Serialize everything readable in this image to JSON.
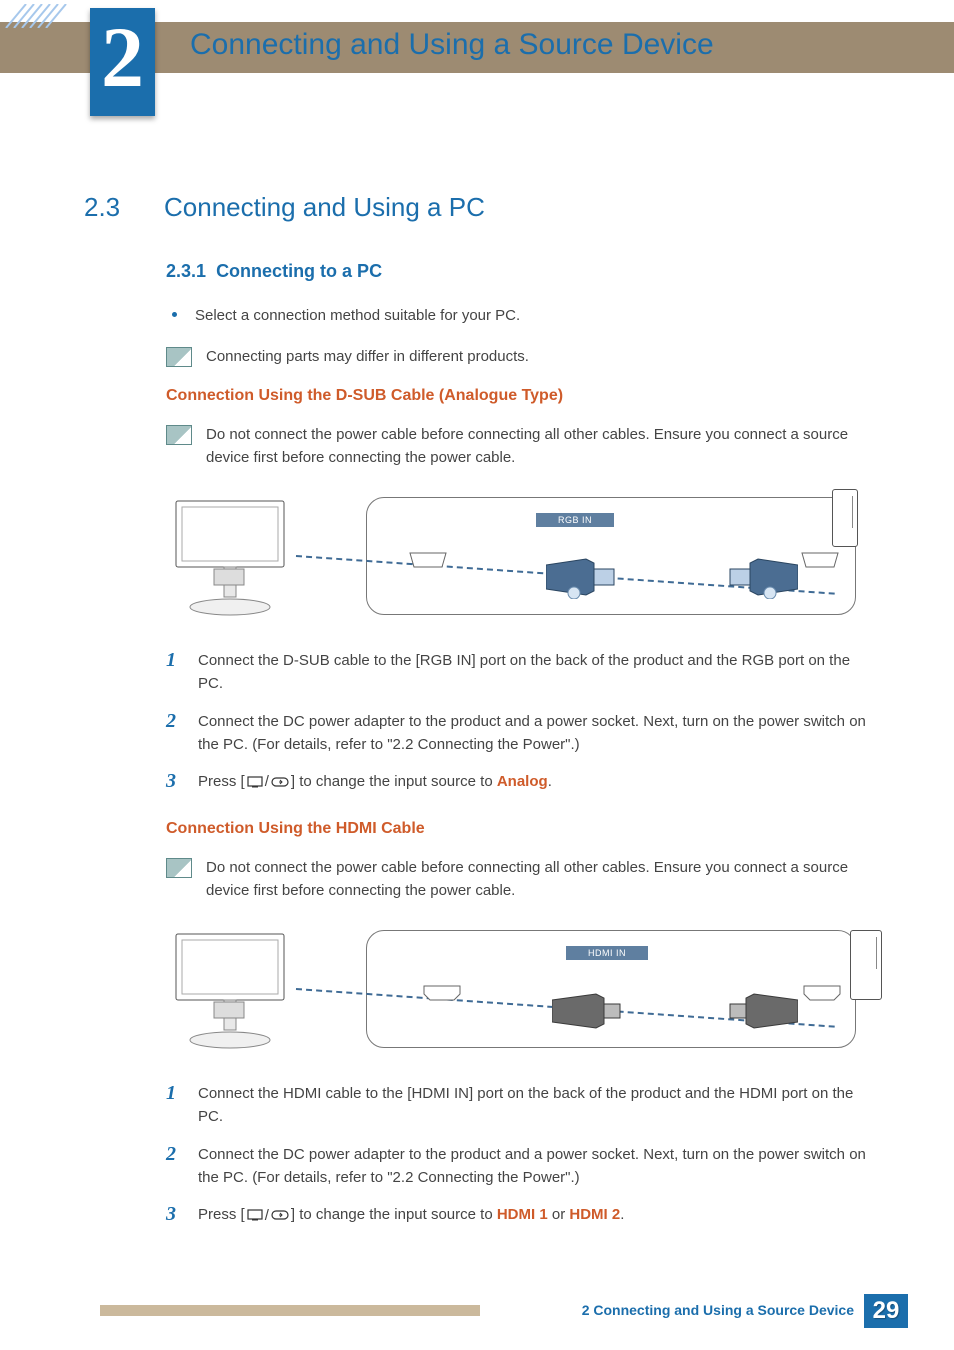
{
  "chapter": {
    "number": "2",
    "title": "Connecting and Using a Source Device"
  },
  "section": {
    "number": "2.3",
    "title": "Connecting and Using a PC"
  },
  "subsection": {
    "number": "2.3.1",
    "title": "Connecting to a PC"
  },
  "bullet1": "Select a connection method suitable for your PC.",
  "note_diff": "Connecting parts may differ in different products.",
  "dsub": {
    "heading": "Connection Using the D-SUB Cable (Analogue Type)",
    "note": "Do not connect the power cable before connecting all other cables. Ensure you connect a source device first before connecting the power cable.",
    "port_label": "RGB IN",
    "steps": [
      "Connect the D-SUB cable to the [RGB IN] port on the back of the product and the RGB port on the PC.",
      "Connect the DC power adapter to the product and a power socket. Next, turn on the power switch on the PC. (For details, refer to \"2.2 Connecting the Power\".)"
    ],
    "step3_prefix": "Press [",
    "step3_mid": "] to change the input source to ",
    "step3_source": "Analog",
    "step3_suffix": "."
  },
  "hdmi": {
    "heading": "Connection Using the HDMI Cable",
    "note": "Do not connect the power cable before connecting all other cables. Ensure you connect a source device first before connecting the power cable.",
    "port_label": "HDMI IN",
    "steps": [
      "Connect the HDMI cable to the [HDMI IN] port on the back of the product and the HDMI port on the PC.",
      "Connect the DC power adapter to the product and a power socket. Next, turn on the power switch on the PC. (For details, refer to \"2.2 Connecting the Power\".)"
    ],
    "step3_prefix": "Press [",
    "step3_mid": "] to change the input source to ",
    "step3_source1": "HDMI 1",
    "step3_or": " or ",
    "step3_source2": "HDMI 2",
    "step3_suffix": "."
  },
  "footer": {
    "text": "2 Connecting and Using a Source Device",
    "page": "29"
  }
}
